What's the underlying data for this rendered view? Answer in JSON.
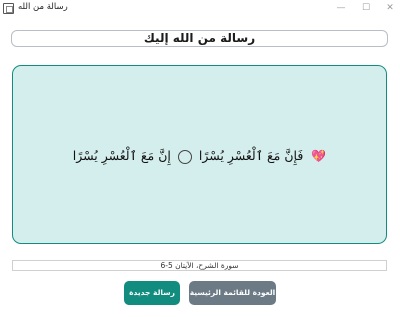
{
  "window": {
    "title": "رسالة من الله",
    "minimize": "—",
    "maximize": "☐",
    "close": "✕"
  },
  "header": {
    "title": "رسالة من الله إليك"
  },
  "verse": {
    "part1": "فَإِنَّ مَعَ ٱلْعُسْرِ يُسْرًا",
    "part2": "إِنَّ مَعَ ٱلْعُسْرِ يُسْرًا",
    "icon": "heart-icon",
    "icon_glyph": "💖"
  },
  "source": {
    "text": "سورة الشرح، الآيتان 5-6"
  },
  "buttons": {
    "back_label": "العودة للقائمة الرئيسية",
    "new_label": "رسالة جديدة"
  },
  "colors": {
    "accent": "#128c7e",
    "panel_bg": "#d3eeed",
    "secondary_button": "#6c7a86"
  }
}
